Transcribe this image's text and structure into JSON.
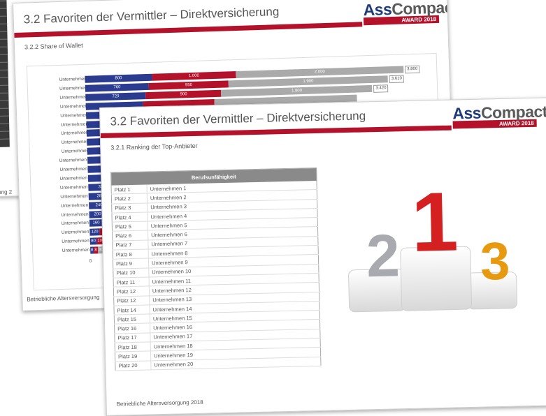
{
  "back_page_top": {
    "side_footer": "ung 2"
  },
  "slide_share": {
    "title": "3.2 Favoriten der Vermittler – Direktversicherung",
    "logo_ass": "Ass",
    "logo_compact": "Compact",
    "logo_award": "AWARD 2018",
    "subtitle": "3.2.2 Share of Wallet",
    "footer": "Betriebliche Altersversorgung",
    "axis_zero": "0",
    "chart_data": {
      "type": "bar",
      "orientation": "horizontal-stacked",
      "categories": [
        "Unternehmen 1",
        "Unternehmen 2",
        "Unternehmen 3",
        "Unternehmen 4",
        "Unternehmen 5",
        "Unternehmen 6",
        "Unternehmen 7",
        "Unternehmen 8",
        "Unternehmen 9",
        "Unternehmen 10",
        "Unternehmen 11",
        "Unternehmen 12",
        "Unternehmen 13",
        "Unternehmen 14",
        "Unternehmen 15",
        "Unternehmen 16",
        "Unternehmen 17",
        "Unternehmen 18",
        "Unternehmen 19",
        "Unternehmen 20"
      ],
      "series": [
        {
          "values": [
            800,
            760,
            720,
            680,
            640,
            600,
            560,
            520,
            480,
            440,
            400,
            360,
            320,
            280,
            240,
            200,
            160,
            120,
            80,
            40
          ],
          "labels": [
            "800",
            "760",
            "720",
            "",
            "",
            "",
            "",
            "",
            "",
            "",
            "4",
            "3",
            "320",
            "280",
            "240",
            "200",
            "160",
            "120",
            "80",
            "8"
          ]
        },
        {
          "values": [
            1000,
            950,
            900,
            850,
            800,
            750,
            700,
            650,
            600,
            550,
            500,
            450,
            400,
            350,
            300,
            250,
            200,
            150,
            100,
            50
          ],
          "labels": [
            "1.000",
            "950",
            "900",
            "",
            "",
            "",
            "",
            "",
            "",
            "",
            "",
            "",
            "",
            "",
            "",
            "",
            "",
            "1",
            "100",
            "8"
          ]
        },
        {
          "values": [
            2000,
            1900,
            1800,
            1700,
            1600,
            1500,
            1400,
            1300,
            1200,
            1100,
            1000,
            900,
            800,
            700,
            600,
            500,
            400,
            300,
            200,
            100
          ],
          "labels": [
            "2.000",
            "1.900",
            "1.800",
            "",
            "",
            "",
            "",
            "",
            "",
            "",
            "",
            "",
            "",
            "",
            "",
            "",
            "",
            "",
            "",
            "300"
          ]
        }
      ],
      "totals": [
        "3.800",
        "3.610",
        "3.420"
      ],
      "colors": [
        "#2b3b8f",
        "#b4122b",
        "#aaaaaa"
      ]
    }
  },
  "slide_ranking": {
    "title": "3.2 Favoriten der Vermittler – Direktversicherung",
    "logo_ass": "Ass",
    "logo_compact": "Compact",
    "logo_award": "AWARD 2018",
    "subtitle": "3.2.1 Ranking der Top-Anbieter",
    "table_header": "Berufsunfähigkeit",
    "rows": [
      [
        "Platz 1",
        "Unternehmen 1"
      ],
      [
        "Platz 2",
        "Unternehmen 2"
      ],
      [
        "Platz 3",
        "Unternehmen 3"
      ],
      [
        "Platz 4",
        "Unternehmen 4"
      ],
      [
        "Platz 5",
        "Unternehmen 5"
      ],
      [
        "Platz 6",
        "Unternehmen 6"
      ],
      [
        "Platz 7",
        "Unternehmen 7"
      ],
      [
        "Platz 8",
        "Unternehmen 8"
      ],
      [
        "Platz 9",
        "Unternehmen 9"
      ],
      [
        "Platz 10",
        "Unternehmen 10"
      ],
      [
        "Platz 11",
        "Unternehmen 11"
      ],
      [
        "Platz 12",
        "Unternehmen 12"
      ],
      [
        "Platz 12",
        "Unternehmen 13"
      ],
      [
        "Platz 14",
        "Unternehmen 14"
      ],
      [
        "Platz 15",
        "Unternehmen 15"
      ],
      [
        "Platz 16",
        "Unternehmen 16"
      ],
      [
        "Platz 17",
        "Unternehmen 17"
      ],
      [
        "Platz 18",
        "Unternehmen 18"
      ],
      [
        "Platz 19",
        "Unternehmen 19"
      ],
      [
        "Platz 20",
        "Unternehmen 20"
      ]
    ],
    "podium": {
      "first": "1",
      "second": "2",
      "third": "3",
      "colors": {
        "first": "#d42020",
        "second": "#a9aab0",
        "third": "#e79a10"
      }
    },
    "footer": "Betriebliche Altersversorgung 2018"
  }
}
